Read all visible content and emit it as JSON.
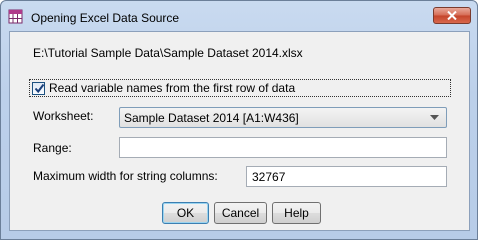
{
  "window": {
    "title": "Opening Excel Data Source",
    "close_icon": "close-icon"
  },
  "source": {
    "path": "E:\\Tutorial Sample Data\\Sample Dataset 2014.xlsx"
  },
  "options": {
    "read_names_label": "Read variable names from the first row of data",
    "read_names_checked": true
  },
  "worksheet": {
    "label": "Worksheet:",
    "selected": "Sample Dataset 2014 [A1:W436]"
  },
  "range": {
    "label": "Range:",
    "value": ""
  },
  "max_width": {
    "label": "Maximum width for string columns:",
    "value": "32767"
  },
  "buttons": {
    "ok": "OK",
    "cancel": "Cancel",
    "help": "Help"
  }
}
